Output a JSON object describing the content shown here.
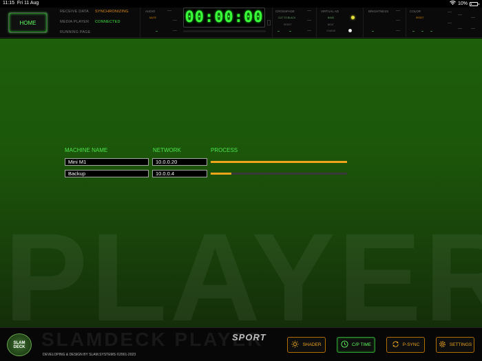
{
  "status_bar": {
    "time": "11:15",
    "date": "Fri 11 Aug",
    "battery": "10%"
  },
  "home_button": "HOME",
  "status": {
    "receive_label": "RECEIVE DATA",
    "receive_value": "SYNCHRONIZING",
    "media_label": "MEDIA PLAYER",
    "media_value": "CONNECTED",
    "running_label": "RUNNING PAGE"
  },
  "controls": {
    "audio": "AUDIO",
    "mute": "MUTE",
    "timer": "00:00:00",
    "crossfade": "CROSSFADE",
    "crossfade_mode": "CUT TO BLACK",
    "reset": "RESET",
    "virtual_ad": "VIRTUAL AD",
    "ad_item1": "BASE",
    "ad_item2": "BEAT",
    "ad_item3": "CHAINS",
    "brightness": "BRIGHTNESS",
    "color": "COLOR",
    "color_reset": "RESET"
  },
  "table": {
    "headers": [
      "MACHINE NAME",
      "NETWORK",
      "PROCESS"
    ],
    "rows": [
      {
        "name": "Mini M1",
        "network": "10.0.0.20",
        "progress": 1.0
      },
      {
        "name": "Backup",
        "network": "10.0.0.4",
        "progress": 0.15
      }
    ]
  },
  "background_word": "PLAYER",
  "footer": {
    "logo_line1": "SLAM",
    "logo_line2": "DECK",
    "watermark": "SLAMDECK PLAYER",
    "edition": "SPORT",
    "copyright": "DEVELOPING & DESIGN BY SLAM.SYSTEMS ©2001-2023",
    "buttons": {
      "shader": "SHADER",
      "cp_time": "C/P TIME",
      "p_sync": "P-SYNC",
      "settings": "SETTINGS"
    }
  },
  "colors": {
    "accent_green": "#38ff38",
    "accent_orange": "#f0a51b",
    "stage_green": "#1e5f0b"
  }
}
